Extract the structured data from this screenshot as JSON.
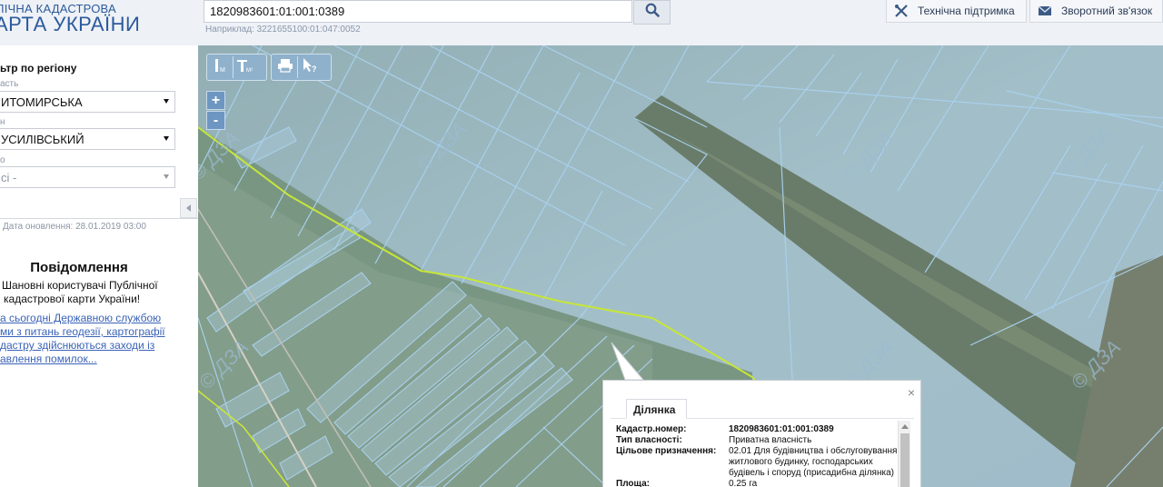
{
  "header": {
    "logo_line1": "ЛІЧНА КАДАСТРОВА",
    "logo_line2": "АРТА УКРАЇНИ",
    "search_value": "1820983601:01:001:0389",
    "search_example": "Наприклад: 3221655100:01:047:0052",
    "support_label": "Технічна підтримка",
    "feedback_label": "Зворотний зв'язок"
  },
  "sidebar": {
    "filter_title": "ьтр по регіону",
    "oblast_label": "асть",
    "oblast_value": "ИТОМИРСЬКА",
    "rayon_label": "н",
    "rayon_value": "УСИЛІВСЬКИЙ",
    "rada_label": "о",
    "rada_value": "сі -",
    "update_date": "Дата оновлення: 28.01.2019 03:00",
    "notice_title": "Повідомлення",
    "notice_text_lines": [
      "Шановні користувачі Публічної",
      "кадастрової карти України!"
    ],
    "notice_link_lines": [
      "а сьогодні Державною службою",
      "ми з питань геодезії, картографії",
      "дастру здійснюються заходи із",
      "авлення помилок..."
    ]
  },
  "map": {
    "watermark": "© ДЗА",
    "zoom_in": "+",
    "zoom_out": "-",
    "tools": [
      "measure-length-icon",
      "measure-area-icon",
      "print-icon",
      "identify-icon"
    ]
  },
  "popup": {
    "tab_label": "Ділянка",
    "close": "×",
    "rows": [
      {
        "key": "Кадастр.номер:",
        "value": "1820983601:01:001:0389"
      },
      {
        "key": "Тип власності:",
        "value": "Приватна власність"
      },
      {
        "key": "Цільове призначення:",
        "value": "02.01 Для будівництва і обслуговування житлового будинку, господарських будівель і споруд (присадибна ділянка)"
      },
      {
        "key": "Площа:",
        "value": "0.25 га"
      }
    ]
  },
  "colors": {
    "brand": "#2b5a9c",
    "parcel_outline": "#a9d2ef",
    "boundary": "#c7e638"
  }
}
